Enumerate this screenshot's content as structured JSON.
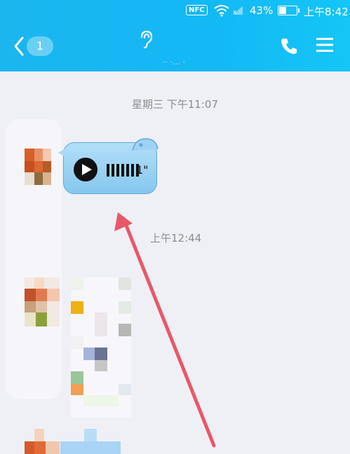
{
  "status_bar": {
    "nfc": "NFC",
    "battery_percent": "43%",
    "battery_level": 0.43,
    "time": "上午8:42"
  },
  "header": {
    "unread_count": "1",
    "subtitle": "·· ·… ·"
  },
  "messages": [
    {
      "timestamp": "星期三 下午11:07",
      "type": "voice",
      "duration": "1\""
    },
    {
      "timestamp": "上午12:44",
      "type": "image"
    }
  ],
  "colors": {
    "header": "#1ab6ee",
    "bubble": "#a4d6f5",
    "arrow": "#e8586a"
  },
  "icons": [
    "back-icon",
    "ear-icon",
    "phone-icon",
    "menu-icon",
    "play-icon",
    "audio-bars-icon"
  ]
}
